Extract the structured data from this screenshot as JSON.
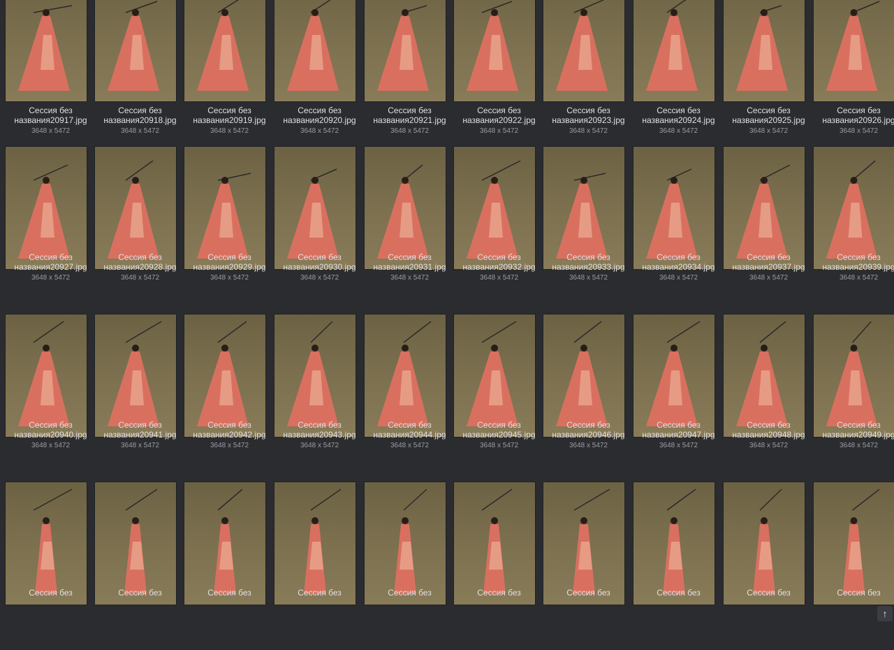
{
  "gallery": {
    "items": [
      {
        "name": "Сессия без\nназвания20917.jpg",
        "dims": "3648 x 5472"
      },
      {
        "name": "Сессия без\nназвания20918.jpg",
        "dims": "3648 x 5472"
      },
      {
        "name": "Сессия без\nназвания20919.jpg",
        "dims": "3648 x 5472"
      },
      {
        "name": "Сессия без\nназвания20920.jpg",
        "dims": "3648 x 5472"
      },
      {
        "name": "Сессия без\nназвания20921.jpg",
        "dims": "3648 x 5472"
      },
      {
        "name": "Сессия без\nназвания20922.jpg",
        "dims": "3648 x 5472"
      },
      {
        "name": "Сессия без\nназвания20923.jpg",
        "dims": "3648 x 5472"
      },
      {
        "name": "Сессия без\nназвания20924.jpg",
        "dims": "3648 x 5472"
      },
      {
        "name": "Сессия без\nназвания20925.jpg",
        "dims": "3648 x 5472"
      },
      {
        "name": "Сессия без\nназвания20926.jpg",
        "dims": "3648 x 5472"
      },
      {
        "name": "Сессия без\nназвания20927.jpg",
        "dims": "3648 x 5472"
      },
      {
        "name": "Сессия без\nназвания20928.jpg",
        "dims": "3648 x 5472"
      },
      {
        "name": "Сессия без\nназвания20929.jpg",
        "dims": "3648 x 5472"
      },
      {
        "name": "Сессия без\nназвания20930.jpg",
        "dims": "3648 x 5472"
      },
      {
        "name": "Сессия без\nназвания20931.jpg",
        "dims": "3648 x 5472"
      },
      {
        "name": "Сессия без\nназвания20932.jpg",
        "dims": "3648 x 5472"
      },
      {
        "name": "Сессия без\nназвания20933.jpg",
        "dims": "3648 x 5472"
      },
      {
        "name": "Сессия без\nназвания20934.jpg",
        "dims": "3648 x 5472"
      },
      {
        "name": "Сессия без\nназвания20937.jpg",
        "dims": "3648 x 5472"
      },
      {
        "name": "Сессия без\nназвания20939.jpg",
        "dims": "3648 x 5472"
      },
      {
        "name": "Сессия без\nназвания20940.jpg",
        "dims": "3648 x 5472"
      },
      {
        "name": "Сессия без\nназвания20941.jpg",
        "dims": "3648 x 5472"
      },
      {
        "name": "Сессия без\nназвания20942.jpg",
        "dims": "3648 x 5472"
      },
      {
        "name": "Сессия без\nназвания20943.jpg",
        "dims": "3648 x 5472"
      },
      {
        "name": "Сессия без\nназвания20944.jpg",
        "dims": "3648 x 5472"
      },
      {
        "name": "Сессия без\nназвания20945.jpg",
        "dims": "3648 x 5472"
      },
      {
        "name": "Сессия без\nназвания20946.jpg",
        "dims": "3648 x 5472"
      },
      {
        "name": "Сессия без\nназвания20947.jpg",
        "dims": "3648 x 5472"
      },
      {
        "name": "Сессия без\nназвания20948.jpg",
        "dims": "3648 x 5472"
      },
      {
        "name": "Сессия без\nназвания20949.jpg",
        "dims": "3648 x 5472"
      },
      {
        "name": "Сессия без",
        "dims": ""
      },
      {
        "name": "Сессия без",
        "dims": ""
      },
      {
        "name": "Сессия без",
        "dims": ""
      },
      {
        "name": "Сессия без",
        "dims": ""
      },
      {
        "name": "Сессия без",
        "dims": ""
      },
      {
        "name": "Сессия без",
        "dims": ""
      },
      {
        "name": "Сессия без",
        "dims": ""
      },
      {
        "name": "Сессия без",
        "dims": ""
      },
      {
        "name": "Сессия без",
        "dims": ""
      },
      {
        "name": "Сессия без",
        "dims": ""
      }
    ]
  },
  "scroll_top": {
    "icon": "arrow-up-icon",
    "glyph": "↑"
  },
  "colors": {
    "background": "#2b2c30",
    "backdrop": "#7d7150",
    "kimono": "#d9705f",
    "text": "#dfe0e3",
    "subtext": "#9c9da2"
  }
}
